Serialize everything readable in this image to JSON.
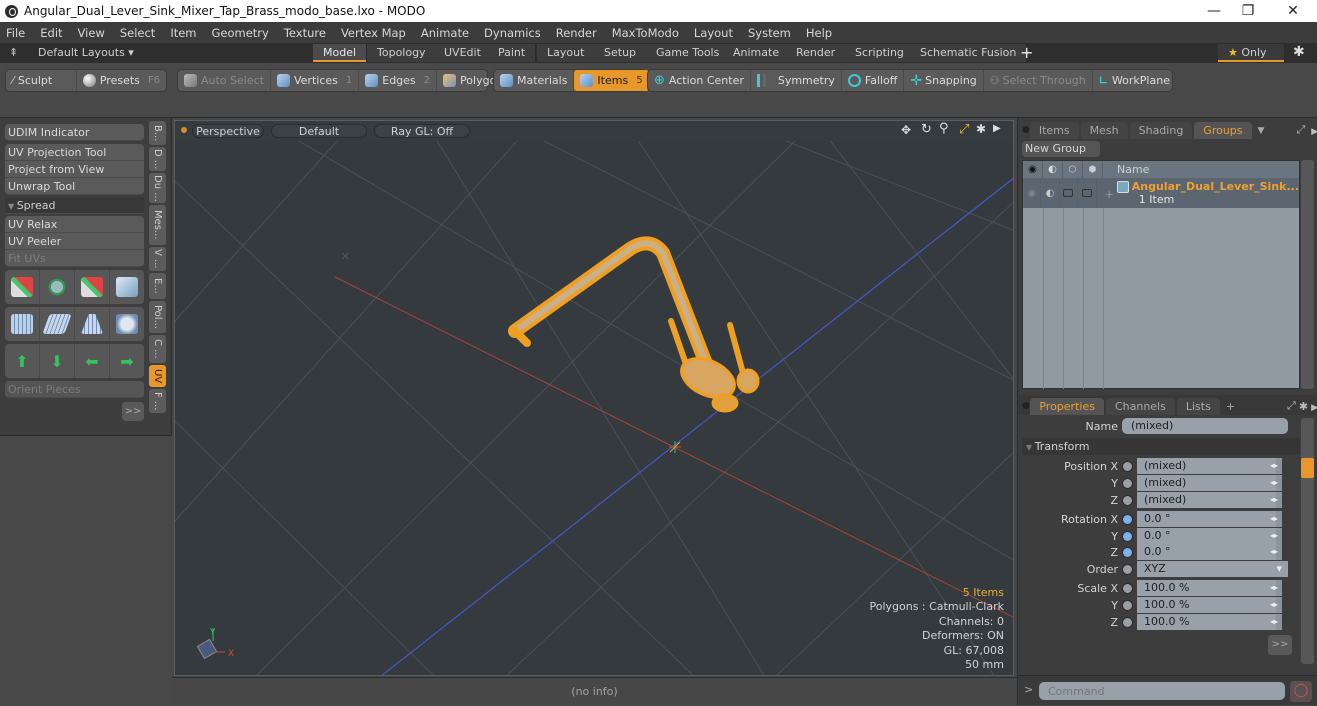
{
  "window": {
    "title": "Angular_Dual_Lever_Sink_Mixer_Tap_Brass_modo_base.lxo - MODO",
    "controls": [
      "—",
      "❐",
      "✕"
    ]
  },
  "menu": [
    "File",
    "Edit",
    "View",
    "Select",
    "Item",
    "Geometry",
    "Texture",
    "Vertex Map",
    "Animate",
    "Dynamics",
    "Render",
    "MaxToModo",
    "Layout",
    "System",
    "Help"
  ],
  "layouts": {
    "selector": "Default Layouts ▾",
    "tabs": [
      "Model",
      "Topology",
      "UVEdit",
      "Paint",
      "Layout",
      "Setup",
      "Game Tools",
      "Animate",
      "Render",
      "Scripting",
      "Schematic Fusion"
    ],
    "active_tab": "Model",
    "add": "+",
    "only_label": "Only",
    "star": "★"
  },
  "toolbar": {
    "sculpt": "Sculpt",
    "presets": "Presets",
    "presets_key": "F6",
    "auto_select": "Auto Select",
    "vertices": "Vertices",
    "vertices_key": "1",
    "edges": "Edges",
    "edges_key": "2",
    "polygons": "Polygons",
    "materials": "Materials",
    "items": "Items",
    "items_key": "5",
    "action_center": "Action Center",
    "symmetry": "Symmetry",
    "falloff": "Falloff",
    "snapping": "Snapping",
    "select_through": "Select Through",
    "workplane": "WorkPlane"
  },
  "left_panel": {
    "buttons": [
      "UDIM Indicator",
      "UV Projection Tool",
      "Project from View",
      "Unwrap Tool"
    ],
    "spread_header": "Spread",
    "buttons2": [
      "UV Relax",
      "UV Peeler",
      "Fit UVs"
    ],
    "orient_pieces": "Orient Pieces",
    "more": ">>",
    "vtabs": [
      "B...",
      "D ...",
      "Du ...",
      "Mes...",
      "V ...",
      "E...",
      "Pol...",
      "C ...",
      "UV",
      "F ..."
    ],
    "active_vtab": "UV"
  },
  "viewport": {
    "view": "Perspective",
    "shading": "Default",
    "raygl": "Ray GL: Off",
    "info": {
      "items": "5 Items",
      "polygons": "Polygons : Catmull-Clark",
      "channels": "Channels: 0",
      "deformers": "Deformers: ON",
      "gl": "GL: 67,008",
      "scale": "50 mm"
    },
    "axis": {
      "y": "Y",
      "x": "X"
    },
    "colors": {
      "wire": "#f0a020",
      "x_axis": "#b04a3a",
      "z_axis": "#4656c8",
      "bg": "#353a3e"
    }
  },
  "status": "(no info)",
  "groups_panel": {
    "tabs": [
      "Items",
      "Mesh ...",
      "Shading",
      "Groups"
    ],
    "active_tab": "Groups",
    "new_group": "New Group",
    "column_name": "Name",
    "group": {
      "name": "Angular_Dual_Lever_Sink...",
      "count": "1 Item"
    }
  },
  "properties_panel": {
    "tabs": [
      "Properties",
      "Channels",
      "Lists"
    ],
    "active_tab": "Properties",
    "add": "+",
    "name_label": "Name",
    "name_value": "(mixed)",
    "transform_header": "Transform",
    "rows": [
      {
        "label": "Position X",
        "value": "(mixed)",
        "dot": "gray"
      },
      {
        "label": "Y",
        "value": "(mixed)",
        "dot": "gray"
      },
      {
        "label": "Z",
        "value": "(mixed)",
        "dot": "gray"
      },
      {
        "label": "Rotation X",
        "value": "0.0 °",
        "dot": "blue"
      },
      {
        "label": "Y",
        "value": "0.0 °",
        "dot": "blue"
      },
      {
        "label": "Z",
        "value": "0.0 °",
        "dot": "blue"
      },
      {
        "label": "Order",
        "value": "XYZ",
        "dot": "gray"
      },
      {
        "label": "Scale X",
        "value": "100.0 %",
        "dot": "gray"
      },
      {
        "label": "Y",
        "value": "100.0 %",
        "dot": "gray"
      },
      {
        "label": "Z",
        "value": "100.0 %",
        "dot": "gray"
      }
    ],
    "more": ">>",
    "command_placeholder": "Command",
    "prompt": ">"
  }
}
